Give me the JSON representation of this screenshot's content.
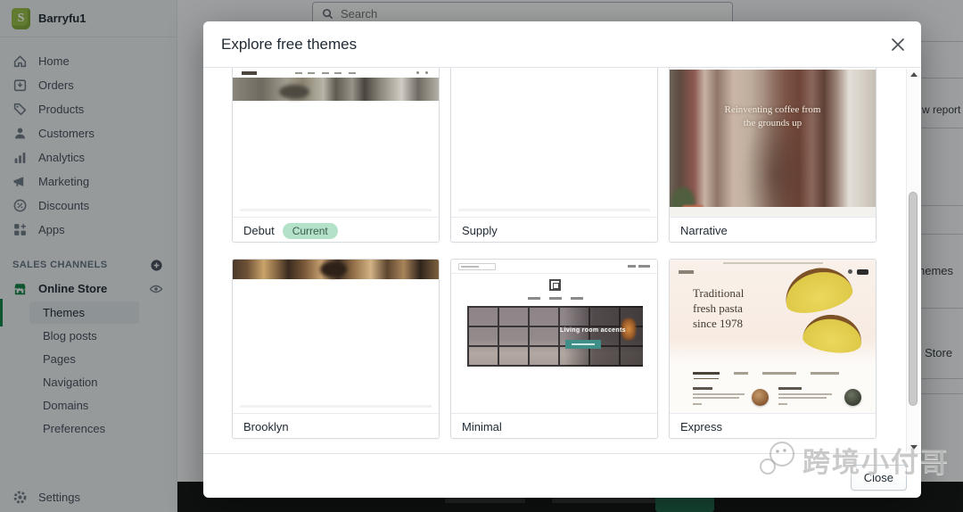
{
  "topbar": {
    "store_name": "Barryfu1",
    "search_placeholder": "Search"
  },
  "sidebar": {
    "nav": [
      {
        "label": "Home",
        "icon": "home-icon"
      },
      {
        "label": "Orders",
        "icon": "orders-icon"
      },
      {
        "label": "Products",
        "icon": "products-icon"
      },
      {
        "label": "Customers",
        "icon": "customers-icon"
      },
      {
        "label": "Analytics",
        "icon": "analytics-icon"
      },
      {
        "label": "Marketing",
        "icon": "marketing-icon"
      },
      {
        "label": "Discounts",
        "icon": "discounts-icon"
      },
      {
        "label": "Apps",
        "icon": "apps-icon"
      }
    ],
    "sales_channels_label": "SALES CHANNELS",
    "online_store_label": "Online Store",
    "sub_nav": [
      {
        "label": "Themes",
        "selected": true
      },
      {
        "label": "Blog posts",
        "selected": false
      },
      {
        "label": "Pages",
        "selected": false
      },
      {
        "label": "Navigation",
        "selected": false
      },
      {
        "label": "Domains",
        "selected": false
      },
      {
        "label": "Preferences",
        "selected": false
      }
    ],
    "settings_label": "Settings"
  },
  "background": {
    "fragments": {
      "view_report": "w report",
      "themes_button": "hemes",
      "store_button": "Store"
    }
  },
  "modal": {
    "title": "Explore free themes",
    "close_label": "Close",
    "themes": [
      {
        "name": "Debut",
        "badge": "Current"
      },
      {
        "name": "Supply"
      },
      {
        "name": "Narrative",
        "caption": "Reinventing coffee from the grounds up"
      },
      {
        "name": "Brooklyn"
      },
      {
        "name": "Minimal",
        "caption": "Living room accents"
      },
      {
        "name": "Express",
        "caption": "Traditional fresh pasta since 1978"
      }
    ]
  },
  "watermark": {
    "text": "跨境小付哥"
  },
  "colors": {
    "shopify_green": "#95bf47",
    "active_nav_green": "#108043",
    "badge_bg": "#b4e2c8",
    "badge_text": "#3c5c4a",
    "minimal_button_teal": "#3f8e88",
    "bottom_bar_button_green": "#1f6a4c"
  }
}
